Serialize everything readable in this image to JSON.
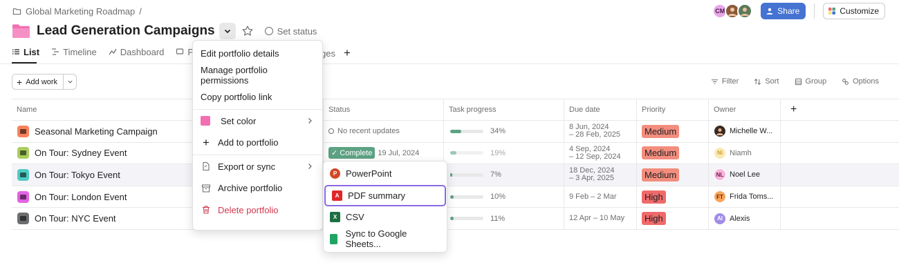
{
  "breadcrumb": {
    "label": "Global Marketing Roadmap",
    "separator": "/"
  },
  "header": {
    "title": "Lead Generation Campaigns",
    "set_status": "Set status"
  },
  "topbar": {
    "avatar_initials": "CM",
    "share_label": "Share",
    "customize_label": "Customize"
  },
  "tabs": {
    "list": "List",
    "timeline": "Timeline",
    "dashboard": "Dashboard",
    "progress_partial": "Pro",
    "messages_partial": "ges",
    "add": "+"
  },
  "toolbar": {
    "add_work": "Add work",
    "filter": "Filter",
    "sort": "Sort",
    "group": "Group",
    "options": "Options"
  },
  "columns": {
    "name": "Name",
    "status": "Status",
    "task_progress": "Task progress",
    "due_date": "Due date",
    "priority": "Priority",
    "owner": "Owner",
    "add": "+"
  },
  "rows": [
    {
      "name": "Seasonal Marketing Campaign",
      "icon_color": "#f9825c",
      "status": "No recent updates",
      "progress_pct": 34,
      "progress_label": "34%",
      "due_line1": "8 Jun, 2024",
      "due_line2": "– 28 Feb, 2025",
      "priority": "Medium",
      "owner_initials": "",
      "owner": "Michelle W...",
      "owner_color": "#3a2a22"
    },
    {
      "name": "On Tour: Sydney Event",
      "icon_color": "#a9ce5e",
      "status_pill": "✓ Complete",
      "status_date": "19 Jul, 2024",
      "progress_pct": 19,
      "progress_label": "19%",
      "due_line1": "4 Sep, 2024",
      "due_line2": "– 12 Sep, 2024",
      "priority": "Medium",
      "owner_initials": "Ni",
      "owner": "Niamh",
      "owner_color": "#f8df72"
    },
    {
      "name": "On Tour: Tokyo Event",
      "icon_color": "#4ecbc4",
      "progress_pct": 7,
      "progress_label": "7%",
      "due_line1": "18 Dec, 2024",
      "due_line2": "– 3 Apr, 2025",
      "priority": "Medium",
      "owner_initials": "NL",
      "owner": "Noel Lee",
      "owner_color": "#f26fb2"
    },
    {
      "name": "On Tour: London Event",
      "icon_color": "#e362e3",
      "progress_pct": 10,
      "progress_label": "10%",
      "due_line1": "9 Feb – 2 Mar",
      "due_line2": "",
      "priority": "High",
      "owner_initials": "FT",
      "owner": "Frida Toms...",
      "owner_color": "#f8a55c"
    },
    {
      "name": "On Tour: NYC Event",
      "icon_color": "#6d6e6f",
      "progress_pct": 11,
      "progress_label": "11%",
      "due_line1": "12 Apr – 10 May",
      "due_line2": "",
      "priority": "High",
      "owner_initials": "AI",
      "owner": "Alexis",
      "owner_color": "#a08ce8"
    }
  ],
  "menu": {
    "edit_details": "Edit portfolio details",
    "manage_permissions": "Manage portfolio permissions",
    "copy_link": "Copy portfolio link",
    "set_color": "Set color",
    "add_to_portfolio": "Add to portfolio",
    "export_or_sync": "Export or sync",
    "archive": "Archive portfolio",
    "delete": "Delete portfolio"
  },
  "submenu": {
    "powerpoint": "PowerPoint",
    "pdf_summary": "PDF summary",
    "csv": "CSV",
    "google_sheets": "Sync to Google Sheets..."
  },
  "colors": {
    "folder": "#f26fb2",
    "share": "#4573d2",
    "complete": "#5da283",
    "priority_medium": "#f38d7d",
    "priority_high": "#f06a6a",
    "danger": "#d1384e",
    "selected_outline": "#8a68e3",
    "powerpoint": "#d24726",
    "pdf": "#e0262a",
    "excel": "#1d6f42",
    "sheets": "#1fa463"
  }
}
